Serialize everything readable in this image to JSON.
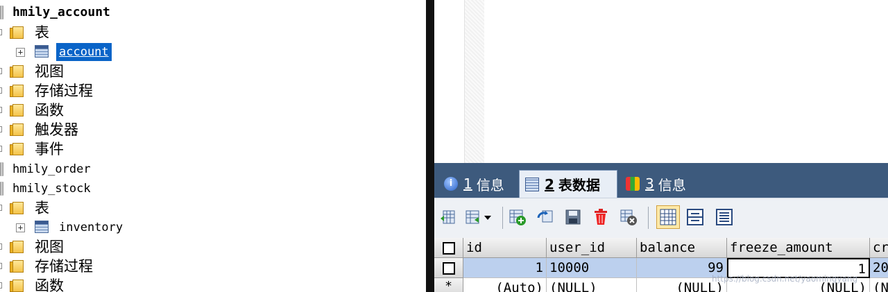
{
  "tree": {
    "db1": {
      "label": "hmily_account"
    },
    "db1_tables": {
      "label": "表"
    },
    "db1_table_account": {
      "label": "account"
    },
    "db1_views": {
      "label": "视图"
    },
    "db1_procs": {
      "label": "存储过程"
    },
    "db1_funcs": {
      "label": "函数"
    },
    "db1_triggers": {
      "label": "触发器"
    },
    "db1_events": {
      "label": "事件"
    },
    "db2": {
      "label": "hmily_order"
    },
    "db3": {
      "label": "hmily_stock"
    },
    "db3_tables": {
      "label": "表"
    },
    "db3_table_inventory": {
      "label": "inventory"
    },
    "db3_views": {
      "label": "视图"
    },
    "db3_procs": {
      "label": "存储过程"
    },
    "db3_funcs": {
      "label": "函数"
    },
    "expand_glyph": "+"
  },
  "tabs": [
    {
      "num": "1",
      "label": "信息",
      "icon": "info-icon"
    },
    {
      "num": "2",
      "label": "表数据",
      "icon": "table-grid-icon",
      "active": true
    },
    {
      "num": "3",
      "label": "信息",
      "icon": "chart-icon"
    }
  ],
  "toolbar_icons": [
    "export-icon",
    "import-dropdown-icon",
    "insert-row-icon",
    "refresh-icon",
    "save-icon",
    "delete-icon",
    "cancel-icon",
    "grid-view-icon",
    "form-view-icon",
    "text-view-icon"
  ],
  "grid": {
    "columns": [
      "id",
      "user_id",
      "balance",
      "freeze_amount",
      "cr"
    ],
    "rows": [
      [
        "1",
        "10000",
        "99",
        "1",
        "20"
      ],
      [
        "(Auto)",
        "(NULL)",
        "(NULL)",
        "(NULL)",
        "(N"
      ]
    ],
    "new_row_marker": "*"
  },
  "watermark": "https://blog.csdn.net/yaomingyang"
}
